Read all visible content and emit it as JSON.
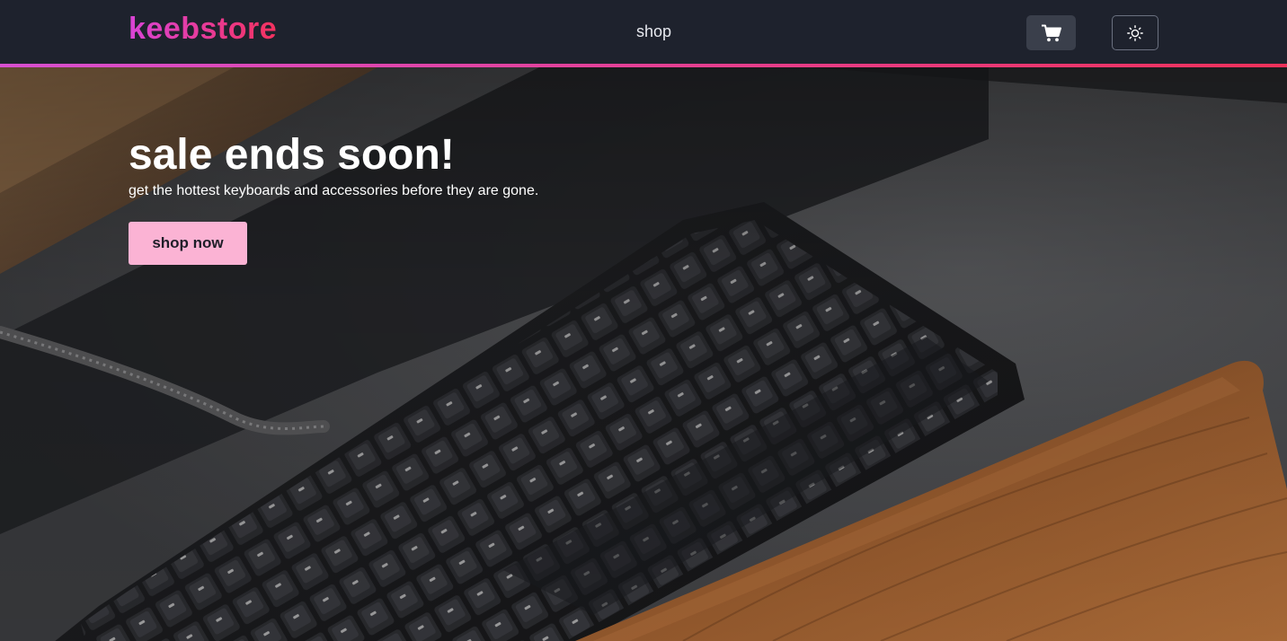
{
  "brand": {
    "logo_text": "keebstore",
    "gradient_start": "#d944d6",
    "gradient_end": "#f4325e"
  },
  "nav": {
    "links": [
      {
        "label": "shop"
      }
    ],
    "cart_icon": "shopping-cart-icon",
    "theme_icon": "sun-icon"
  },
  "hero": {
    "title": "sale ends soon!",
    "subtitle": "get the hottest keyboards and accessories before they are gone.",
    "cta_label": "shop now",
    "cta_color": "#fbb3d4",
    "background_image": "dark mechanical keyboard with wooden wrist rest on grey felt desk mat"
  }
}
